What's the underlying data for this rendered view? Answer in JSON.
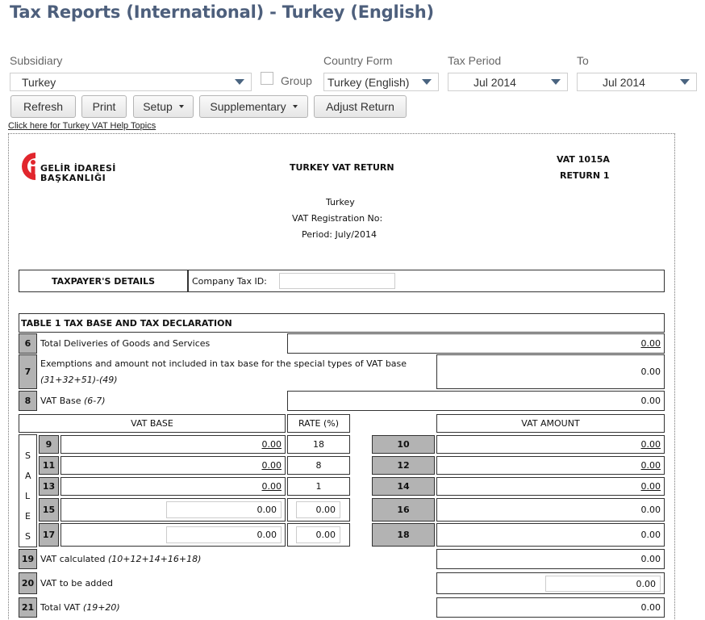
{
  "page_title": "Tax Reports (International) - Turkey (English)",
  "filters": {
    "subsidiary_label": "Subsidiary",
    "subsidiary_value": "Turkey",
    "group_label": "Group",
    "country_form_label": "Country Form",
    "country_form_value": "Turkey (English)",
    "tax_period_label": "Tax Period",
    "tax_period_value": "Jul 2014",
    "to_label": "To",
    "to_value": "Jul 2014"
  },
  "toolbar": {
    "refresh": "Refresh",
    "print": "Print",
    "setup": "Setup",
    "supplementary": "Supplementary",
    "adjust_return": "Adjust Return"
  },
  "help_link": "Click here for Turkey VAT Help Topics",
  "logo": {
    "line1": "GELİR İDARESİ",
    "line2": "BAŞKANLIĞI"
  },
  "header": {
    "title": "TURKEY VAT RETURN",
    "form_code": "VAT 1015A",
    "return_no": "RETURN 1",
    "country": "Turkey",
    "vat_reg": "VAT Registration No:",
    "period": "Period: July/2014"
  },
  "taxpayer": {
    "section_label": "TAXPAYER'S DETAILS",
    "company_tax_id_label": "Company Tax ID:"
  },
  "table1": {
    "title": "TABLE 1 TAX BASE AND TAX DECLARATION",
    "row6": {
      "num": "6",
      "label": "Total Deliveries of Goods and Services",
      "value": "0.00"
    },
    "row7": {
      "num": "7",
      "label": "Exemptions and amount not included in tax base for the special types of VAT base",
      "formula": "(31+32+51)-(49)",
      "value": "0.00"
    },
    "row8": {
      "num": "8",
      "label": "VAT Base",
      "formula": "(6-7)",
      "value": "0.00"
    },
    "col_vat_base": "VAT BASE",
    "col_rate": "RATE (%)",
    "col_vat_amount": "VAT AMOUNT",
    "sales_letters": [
      "S",
      "A",
      "L",
      "E",
      "S"
    ],
    "sales_rows": [
      {
        "num": "9",
        "base": "0.00",
        "rate": "18",
        "amt_num": "10",
        "amount": "0.00"
      },
      {
        "num": "11",
        "base": "0.00",
        "rate": "8",
        "amt_num": "12",
        "amount": "0.00"
      },
      {
        "num": "13",
        "base": "0.00",
        "rate": "1",
        "amt_num": "14",
        "amount": "0.00"
      },
      {
        "num": "15",
        "base": "0.00",
        "rate": "0.00",
        "amt_num": "16",
        "amount": "0.00"
      },
      {
        "num": "17",
        "base": "0.00",
        "rate": "0.00",
        "amt_num": "18",
        "amount": "0.00"
      }
    ],
    "row19": {
      "num": "19",
      "label": "VAT calculated",
      "formula": "(10+12+14+16+18)",
      "value": "0.00"
    },
    "row20": {
      "num": "20",
      "label": "VAT to be added",
      "value": "0.00"
    },
    "row21": {
      "num": "21",
      "label": "Total VAT",
      "formula": "(19+20)",
      "value": "0.00"
    }
  },
  "colors": {
    "title": "#4d5f7c",
    "caret": "#4a6480",
    "cell_grey": "#b3b3b3",
    "logo_red": "#e1262d"
  }
}
